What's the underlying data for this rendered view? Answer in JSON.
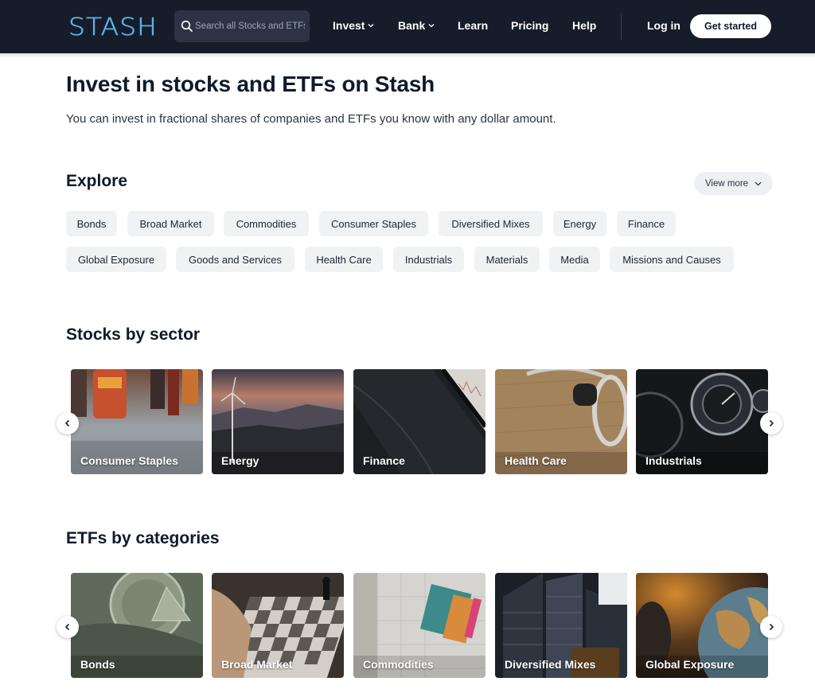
{
  "nav": {
    "logo_text": "STASH",
    "search": {
      "placeholder": "Search all Stocks and ETFs"
    },
    "links": [
      {
        "label": "Invest",
        "dropdown": true
      },
      {
        "label": "Bank",
        "dropdown": true
      },
      {
        "label": "Learn",
        "dropdown": false
      },
      {
        "label": "Pricing",
        "dropdown": false
      },
      {
        "label": "Help",
        "dropdown": false
      }
    ],
    "login_label": "Log in",
    "cta_label": "Get started"
  },
  "hero": {
    "title": "Invest in stocks and ETFs on Stash",
    "subtitle": "You can invest in fractional shares of companies and ETFs you know with any dollar amount."
  },
  "explore": {
    "title": "Explore",
    "view_more_label": "View more",
    "chips": [
      "Bonds",
      "Broad Market",
      "Commodities",
      "Consumer Staples",
      "Diversified Mixes",
      "Energy",
      "Finance",
      "Global Exposure",
      "Goods and Services",
      "Health Care",
      "Industrials",
      "Materials",
      "Media",
      "Missions and Causes"
    ]
  },
  "sectors": {
    "title": "Stocks by sector",
    "cards": [
      "Consumer Staples",
      "Energy",
      "Finance",
      "Health Care",
      "Industrials"
    ]
  },
  "etfs": {
    "title": "ETFs by categories",
    "cards": [
      "Bonds",
      "Broad Market",
      "Commodities",
      "Diversified Mixes",
      "Global Exposure"
    ]
  },
  "colors": {
    "nav_bg": "#161c2a",
    "logo": "#5bb3e6",
    "chip_bg": "#f1f2f4",
    "text_dark": "#0f1a2a"
  },
  "icons": {
    "search": "search-icon",
    "chevron_down": "chevron-down-icon",
    "carousel_prev": "chevron-left-icon",
    "carousel_next": "chevron-right-icon"
  }
}
